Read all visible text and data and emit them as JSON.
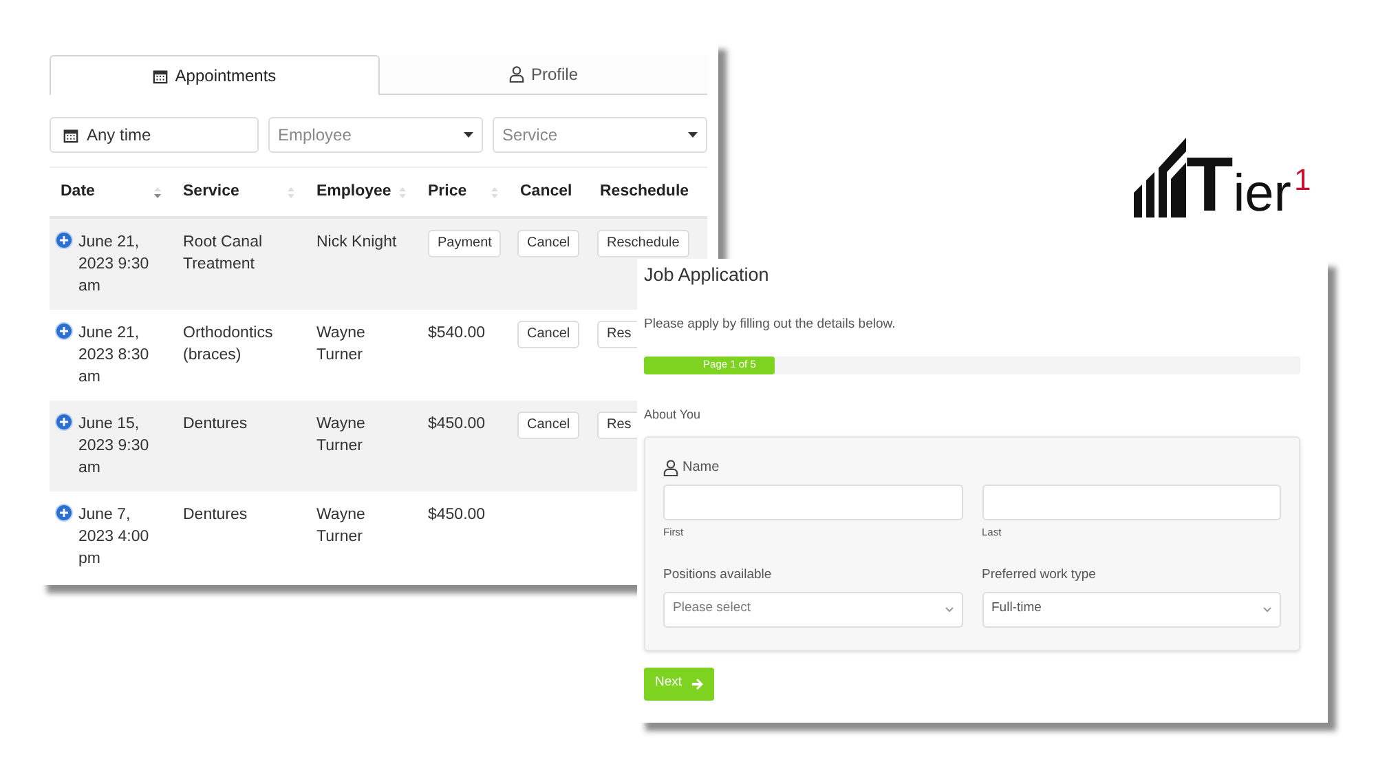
{
  "appointments": {
    "tabs": [
      {
        "label": "Appointments",
        "selected": true
      },
      {
        "label": "Profile",
        "selected": false
      }
    ],
    "filters": {
      "date": "Any time",
      "employee": "Employee",
      "service": "Service"
    },
    "table": {
      "columns": [
        {
          "label": "Date",
          "sortable": true,
          "sorted": true
        },
        {
          "label": "Service",
          "sortable": true,
          "sorted": false
        },
        {
          "label": "Employee",
          "sortable": true,
          "sorted": false
        },
        {
          "label": "Price",
          "sortable": true,
          "sorted": false
        },
        {
          "label": "Cancel",
          "sortable": false
        },
        {
          "label": "Reschedule",
          "sortable": false
        }
      ],
      "rows": [
        {
          "date": "June 21, 2023 9:30 am",
          "service": "Root Canal Treatment",
          "employee": "Nick Knight",
          "price": {
            "kind": "button",
            "text": "Payment"
          },
          "cancel": "Cancel",
          "reschedule": "Reschedule"
        },
        {
          "date": "June 21, 2023 8:30 am",
          "service": "Orthodontics (braces)",
          "employee": "Wayne Turner",
          "price": {
            "kind": "text",
            "text": "$540.00"
          },
          "cancel": "Cancel",
          "reschedule": "Res"
        },
        {
          "date": "June 15, 2023 9:30 am",
          "service": "Dentures",
          "employee": "Wayne Turner",
          "price": {
            "kind": "text",
            "text": "$450.00"
          },
          "cancel": "Cancel",
          "reschedule": "Res"
        },
        {
          "date": "June 7, 2023 4:00 pm",
          "service": "Dentures",
          "employee": "Wayne Turner",
          "price": {
            "kind": "text",
            "text": "$450.00"
          }
        }
      ]
    }
  },
  "logo": {
    "text": "**T**ier",
    "superscript": "1"
  },
  "job_application": {
    "title": "Job Application",
    "subtitle": "Please apply by filling out the details below.",
    "progress": {
      "label": "Page 1 of 5",
      "level": 0.2
    },
    "section": "About You",
    "name": {
      "label": "Name",
      "first": "First",
      "last": "Last"
    },
    "positions": {
      "label": "Positions available",
      "placeholder": "Please select"
    },
    "work_type": {
      "label": "Preferred work type",
      "value": "Full-time"
    },
    "next_button": "Next"
  }
}
